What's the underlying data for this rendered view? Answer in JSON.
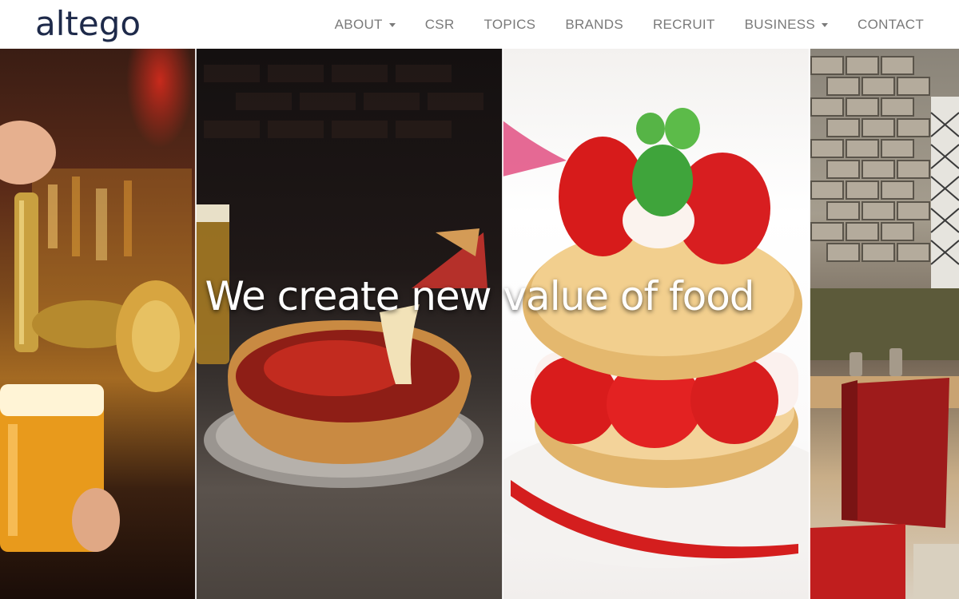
{
  "header": {
    "logo_text": "altego",
    "nav": [
      {
        "label": "ABOUT",
        "has_dropdown": true
      },
      {
        "label": "CSR",
        "has_dropdown": false
      },
      {
        "label": "TOPICS",
        "has_dropdown": false
      },
      {
        "label": "BRANDS",
        "has_dropdown": false
      },
      {
        "label": "RECRUIT",
        "has_dropdown": false
      },
      {
        "label": "BUSINESS",
        "has_dropdown": true
      },
      {
        "label": "CONTACT",
        "has_dropdown": false
      }
    ]
  },
  "hero": {
    "title": "We create new value of food",
    "panels": [
      {
        "name": "beer-tap-photo"
      },
      {
        "name": "deep-dish-pizza-photo"
      },
      {
        "name": "strawberry-shortcake-photo"
      },
      {
        "name": "restaurant-interior-photo"
      }
    ]
  },
  "colors": {
    "logo": "#1e2a4a",
    "nav_text": "#7a7a7a",
    "header_bg": "#ffffff",
    "hero_text": "#ffffff"
  }
}
